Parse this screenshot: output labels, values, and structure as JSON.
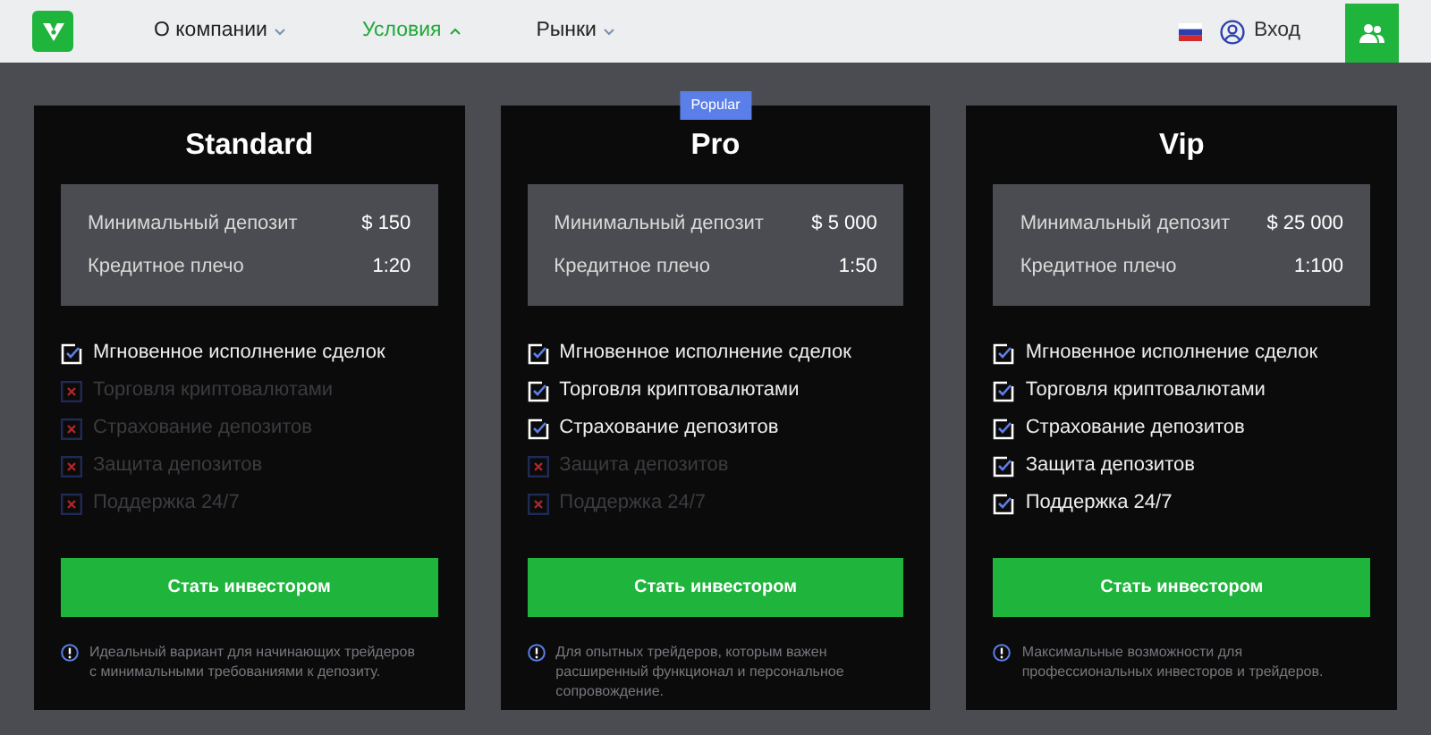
{
  "nav": {
    "items": [
      {
        "label": "О компании",
        "expanded": false,
        "selected": false
      },
      {
        "label": "Условия",
        "expanded": true,
        "selected": true
      },
      {
        "label": "Рынки",
        "expanded": false,
        "selected": false
      }
    ],
    "login": "Вход"
  },
  "plans": [
    {
      "name": "Standard",
      "stats": [
        {
          "label": "Минимальный депозит",
          "value": "$ 150"
        },
        {
          "label": "Кредитное плечо",
          "value": "1:20"
        }
      ],
      "features": [
        {
          "label": "Мгновенное исполнение сделок",
          "included": true
        },
        {
          "label": "Торговля криптовалютами",
          "included": false
        },
        {
          "label": "Страхование депозитов",
          "included": false
        },
        {
          "label": "Защита депозитов",
          "included": false
        },
        {
          "label": "Поддержка 24/7",
          "included": false
        }
      ],
      "button": "Стать инвестором",
      "note": "Идеальный вариант для начинающих трейдеров с минимальными требованиями к депозиту."
    },
    {
      "name": "Pro",
      "badge": "Popular",
      "stats": [
        {
          "label": "Минимальный депозит",
          "value": "$ 5 000"
        },
        {
          "label": "Кредитное плечо",
          "value": "1:50"
        }
      ],
      "features": [
        {
          "label": "Мгновенное исполнение сделок",
          "included": true
        },
        {
          "label": "Торговля криптовалютами",
          "included": true
        },
        {
          "label": "Страхование депозитов",
          "included": true
        },
        {
          "label": "Защита депозитов",
          "included": false
        },
        {
          "label": "Поддержка 24/7",
          "included": false
        }
      ],
      "button": "Стать инвестором",
      "note": "Для опытных трейдеров, которым важен расширенный функционал и персональное сопровождение."
    },
    {
      "name": "Vip",
      "stats": [
        {
          "label": "Минимальный депозит",
          "value": "$ 25 000"
        },
        {
          "label": "Кредитное плечо",
          "value": "1:100"
        }
      ],
      "features": [
        {
          "label": "Мгновенное исполнение сделок",
          "included": true
        },
        {
          "label": "Торговля криптовалютами",
          "included": true
        },
        {
          "label": "Страхование депозитов",
          "included": true
        },
        {
          "label": "Защита депозитов",
          "included": true
        },
        {
          "label": "Поддержка 24/7",
          "included": true
        }
      ],
      "button": "Стать инвестором",
      "note": "Максимальные возможности для профессиональных инвесторов и трейдеров."
    }
  ]
}
